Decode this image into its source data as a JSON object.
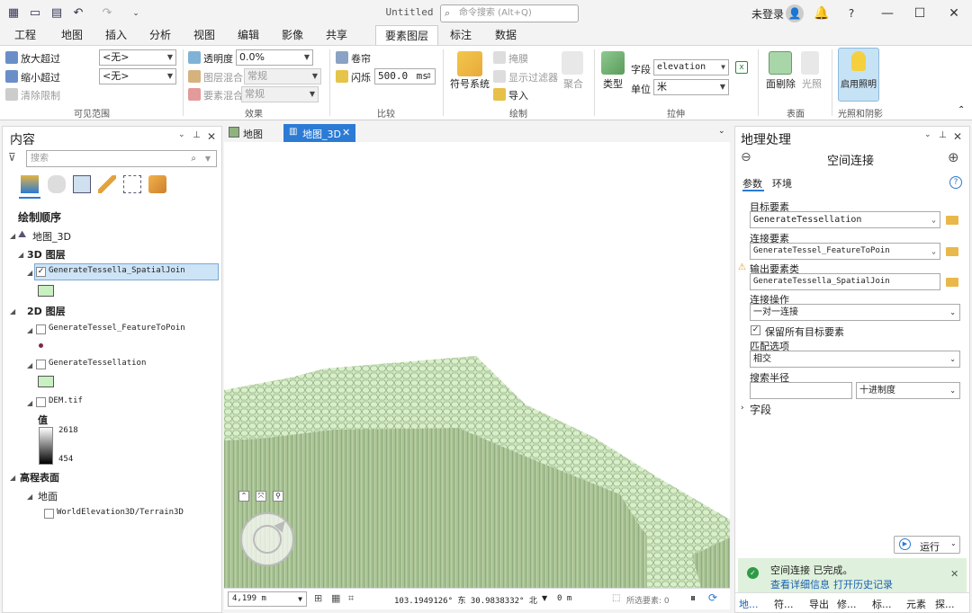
{
  "titlebar": {
    "title": "Untitled",
    "search_placeholder": "命令搜索 (Alt+Q)",
    "login": "未登录",
    "avatar": "👤",
    "bell": "🔔",
    "help": "?",
    "minimize": "—",
    "maximize": "☐",
    "close": "✕"
  },
  "tabs": [
    "工程",
    "地图",
    "插入",
    "分析",
    "视图",
    "编辑",
    "影像",
    "共享",
    "要素图层",
    "标注",
    "数据"
  ],
  "ribbon": {
    "zoom_in_beyond": "放大超过",
    "zoom_out_beyond": "缩小超过",
    "clear_limits": "清除限制",
    "none1": "<无>",
    "none2": "<无>",
    "visible_range": "可见范围",
    "transparency": "透明度",
    "transparency_value": "0.0%",
    "layer_blend": "图层混合",
    "layer_blend_value": "常规",
    "feature_blend": "要素混合",
    "feature_blend_value": "常规",
    "effects": "效果",
    "swipe": "卷帘",
    "flicker": "闪烁",
    "flicker_value": "500.0",
    "flicker_unit": "ms",
    "compare": "比较",
    "symbology": "符号系统",
    "mask": "掩膜",
    "show_filter": "显示过滤器",
    "import": "导入",
    "aggregate": "聚合",
    "drawing": "绘制",
    "type": "类型",
    "field": "字段",
    "field_value": "elevation",
    "unit": "单位",
    "unit_value": "米",
    "extrusion": "拉伸",
    "face_culling": "面剔除",
    "lighting": "光照",
    "surface": "表面",
    "enable_lighting": "启用照明",
    "light_shadow": "光照和阴影"
  },
  "contents": {
    "title": "内容",
    "search_placeholder": "搜索",
    "drawing_order": "绘制顺序",
    "map_name": "地图_3D",
    "group_3d": "3D 图层",
    "layer_spatialjoin": "GenerateTessella_SpatialJoin",
    "group_2d": "2D 图层",
    "layer_featuretopoint": "GenerateTessel_FeatureToPoin",
    "layer_tessellation": "GenerateTessellation",
    "layer_dem": "DEM.tif",
    "value_label": "值",
    "value_max": "2618",
    "value_min": "454",
    "elevation_surfaces": "高程表面",
    "ground": "地面",
    "terrain": "WorldElevation3D/Terrain3D"
  },
  "map_tabs": {
    "map": "地图",
    "map3d": "地图_3D"
  },
  "map_status": {
    "scale": "4,199 m",
    "coords": "103.1949126° 东 30.9838332° 北",
    "elev": "0 m",
    "selected": "所选要素: 0"
  },
  "geoprocessing": {
    "title": "地理处理",
    "tool_name": "空间连接",
    "tab_params": "参数",
    "tab_env": "环境",
    "target_label": "目标要素",
    "target_value": "GenerateTessellation",
    "join_label": "连接要素",
    "join_value": "GenerateTessel_FeatureToPoin",
    "output_label": "输出要素类",
    "output_value": "GenerateTessella_SpatialJoin",
    "operation_label": "连接操作",
    "operation_value": "一对一连接",
    "keep_all": "保留所有目标要素",
    "match_label": "匹配选项",
    "match_value": "相交",
    "radius_label": "搜索半径",
    "radius_unit": "十进制度",
    "fields": "字段",
    "run": "运行",
    "status": "空间连接 已完成。",
    "details": "查看详细信息",
    "history": "打开历史记录",
    "bottom_tabs": [
      "地...",
      "符...",
      "导出",
      "修...",
      "标...",
      "元素",
      "探..."
    ]
  }
}
